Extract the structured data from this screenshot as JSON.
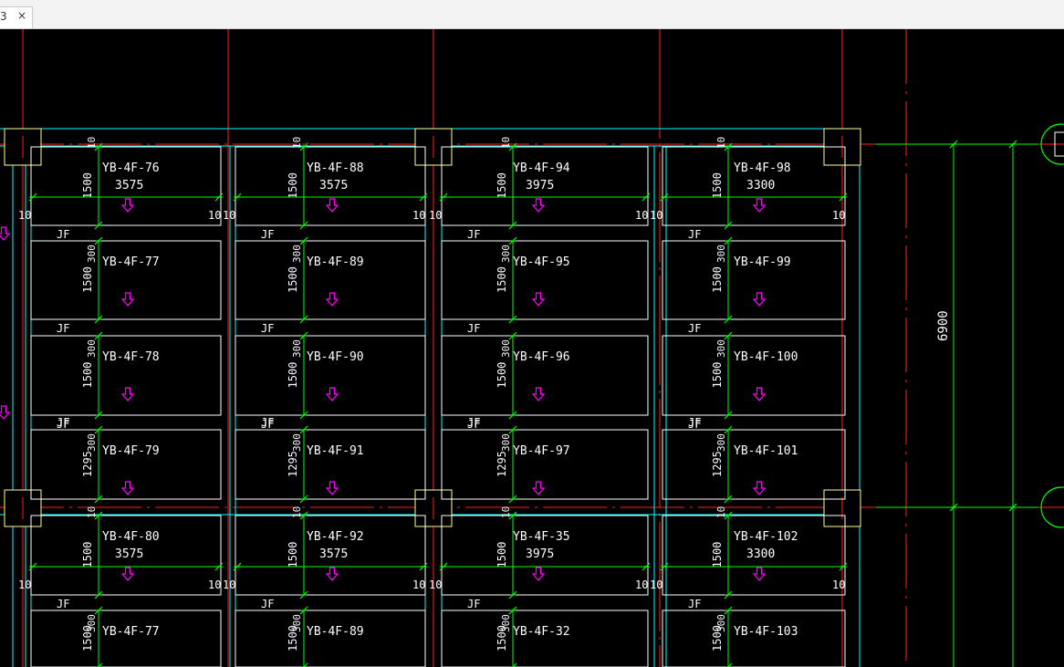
{
  "tab": {
    "label": "3",
    "close_glyph": "×"
  },
  "colors": {
    "background": "#000000",
    "panel": "#ffffff",
    "dim": "#00ff00",
    "axis": "#ff2020",
    "beam": "#00ffff",
    "column": "#ffff99",
    "arrow": "#ff00ff",
    "text": "#ffffff"
  },
  "overall_dimension": "6900",
  "bays": [
    {
      "top_label": "YB-4F-76",
      "top_len": "3575",
      "labels": [
        "YB-4F-77",
        "YB-4F-78",
        "YB-4F-79"
      ],
      "bottom_label": "YB-4F-80",
      "bottom_len": "3575",
      "last_label": "YB-4F-77"
    },
    {
      "top_label": "YB-4F-88",
      "top_len": "3575",
      "labels": [
        "YB-4F-89",
        "YB-4F-90",
        "YB-4F-91"
      ],
      "bottom_label": "YB-4F-92",
      "bottom_len": "3575",
      "last_label": "YB-4F-89"
    },
    {
      "top_label": "YB-4F-94",
      "top_len": "3975",
      "labels": [
        "YB-4F-95",
        "YB-4F-96",
        "YB-4F-97"
      ],
      "bottom_label": "YB-4F-35",
      "bottom_len": "3975",
      "last_label": "YB-4F-32"
    },
    {
      "top_label": "YB-4F-98",
      "top_len": "3300",
      "labels": [
        "YB-4F-99",
        "YB-4F-100",
        "YB-4F-101"
      ],
      "bottom_label": "YB-4F-102",
      "bottom_len": "3300",
      "last_label": "YB-4F-103"
    }
  ],
  "row_dims": [
    "1500",
    "1500",
    "1500",
    "1295",
    "1500",
    "1500"
  ],
  "gap_dims": [
    "10",
    "300"
  ],
  "joint_label": "JF"
}
